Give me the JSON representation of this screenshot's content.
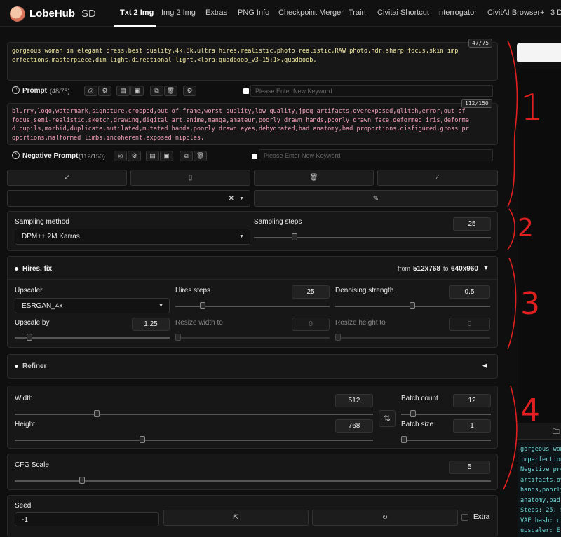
{
  "app": {
    "brand": "LobeHub",
    "suffix": "SD"
  },
  "tabs": [
    "Txt 2 Img",
    "Img 2 Img",
    "Extras",
    "PNG Info",
    "Checkpoint Merger",
    "Train",
    "Civitai Shortcut",
    "Interrogator",
    "CivitAI Browser+",
    "3 D"
  ],
  "prompt": {
    "text": "gorgeous woman in elegant dress,best quality,4k,8k,ultra hires,realistic,photo realistic,RAW photo,hdr,sharp focus,skin imperfections,masterpiece,dim light,directional light,<lora:quadboob_v3-15:1>,quadboob,",
    "counter": "47/75",
    "label": "Prompt",
    "count_label": "(48/75)",
    "keyword_placeholder": "Please Enter New Keyword"
  },
  "negative": {
    "text": "blurry,logo,watermark,signature,cropped,out of frame,worst quality,low quality,jpeg artifacts,overexposed,glitch,error,out of focus,semi-realistic,sketch,drawing,digital art,anime,manga,amateur,poorly drawn hands,poorly drawn face,deformed iris,deformed pupils,morbid,duplicate,mutilated,mutated hands,poorly drawn eyes,dehydrated,bad anatomy,bad proportions,disfigured,gross proportions,malformed limbs,incoherent,exposed nipples,",
    "counter": "112/150",
    "label": "Negative Prompt",
    "count_label": "(112/150)",
    "keyword_placeholder": "Please Enter New Keyword"
  },
  "sampling": {
    "method_label": "Sampling method",
    "method_value": "DPM++ 2M Karras",
    "steps_label": "Sampling steps",
    "steps_value": "25",
    "steps_fraction": 0.17
  },
  "hires": {
    "title": "Hires. fix",
    "from_prefix": "from",
    "from_size": "512x768",
    "to_word": "to",
    "to_size": "640x960",
    "upscaler_label": "Upscaler",
    "upscaler_value": "ESRGAN_4x",
    "steps_label": "Hires steps",
    "steps_value": "25",
    "denoise_label": "Denoising strength",
    "denoise_value": "0.5",
    "upscale_label": "Upscale by",
    "upscale_value": "1.25",
    "resize_w_label": "Resize width to",
    "resize_w_value": "0",
    "resize_h_label": "Resize height to",
    "resize_h_value": "0"
  },
  "refiner": {
    "title": "Refiner"
  },
  "size": {
    "width_label": "Width",
    "width_value": "512",
    "height_label": "Height",
    "height_value": "768",
    "batch_count_label": "Batch count",
    "batch_count_value": "12",
    "batch_size_label": "Batch size",
    "batch_size_value": "1"
  },
  "cfg": {
    "label": "CFG Scale",
    "value": "5"
  },
  "seed": {
    "label": "Seed",
    "value": "-1",
    "extra_label": "Extra"
  },
  "annotations": [
    "1",
    "2",
    "3",
    "4"
  ],
  "log_lines": [
    "gorgeous wom",
    "imperfection",
    "Negative pro",
    "artifacts,ov",
    "hands,poorly",
    "anatomy,bad",
    "Steps: 25, S",
    "VAE hash: c",
    "upscaler: E"
  ],
  "colors": {
    "annotation": "#e02020",
    "prompt_text": "#f0e6a0",
    "negative_text": "#f0a0b8",
    "log_text": "#6fd6d6"
  }
}
